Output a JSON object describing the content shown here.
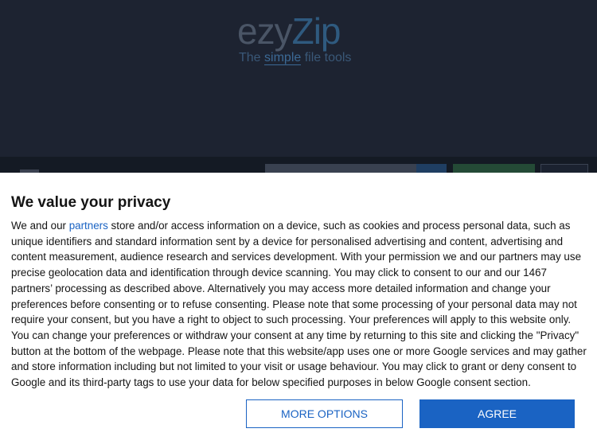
{
  "site": {
    "logo_part1": "ezy",
    "logo_part2": "Zip",
    "tagline_the": "The",
    "tagline_simple": "simple",
    "tagline_rest": "file tools"
  },
  "consent": {
    "title": "We value your privacy",
    "body_before_link": "We and our ",
    "link_text": "partners",
    "body_after_link": " store and/or access information on a device, such as cookies and process personal data, such as unique identifiers and standard information sent by a device for personalised advertising and content, advertising and content measurement, audience research and services development. With your permission we and our partners may use precise geolocation data and identification through device scanning. You may click to consent to our and our 1467 partners’ processing as described above. Alternatively you may access more detailed information and change your preferences before consenting or to refuse consenting. Please note that some processing of your personal data may not require your consent, but you have a right to object to such processing. Your preferences will apply to this website only. You can change your preferences or withdraw your consent at any time by returning to this site and clicking the \"Privacy\" button at the bottom of the webpage. Please note that this website/app uses one or more Google services and may gather and store information including but not limited to your visit or usage behaviour. You may click to grant or deny consent to Google and its third-party tags to use your data for below specified purposes in below Google consent section.",
    "more_options_label": "MORE OPTIONS",
    "agree_label": "AGREE"
  },
  "colors": {
    "accent": "#1a63c3",
    "overlay_bg": "#1d2331"
  }
}
